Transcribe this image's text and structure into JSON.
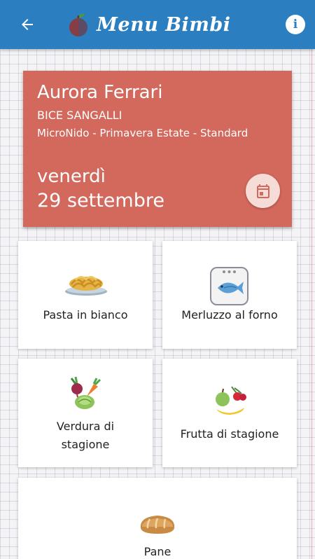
{
  "appbar": {
    "title": "Menu Bimbi",
    "back_icon": "arrow-left-icon",
    "info_icon": "info-icon",
    "info_glyph": "i",
    "color": "#2b7fc0"
  },
  "header_card": {
    "child_name": "Aurora Ferrari",
    "school": "BICE SANGALLI",
    "plan": "MicroNido - Primavera Estate - Standard",
    "weekday": "venerdì",
    "date": "29 settembre",
    "calendar_icon": "calendar-icon",
    "color": "#d3685c"
  },
  "menu": {
    "items": [
      {
        "label": "Pasta in bianco",
        "icon": "pasta-icon"
      },
      {
        "label": "Merluzzo al forno",
        "icon": "fish-icon"
      },
      {
        "label": "Verdura di\nstagione",
        "icon": "vegetables-icon"
      },
      {
        "label": "Frutta di stagione",
        "icon": "fruit-icon"
      },
      {
        "label": "Pane",
        "icon": "bread-icon"
      }
    ]
  }
}
